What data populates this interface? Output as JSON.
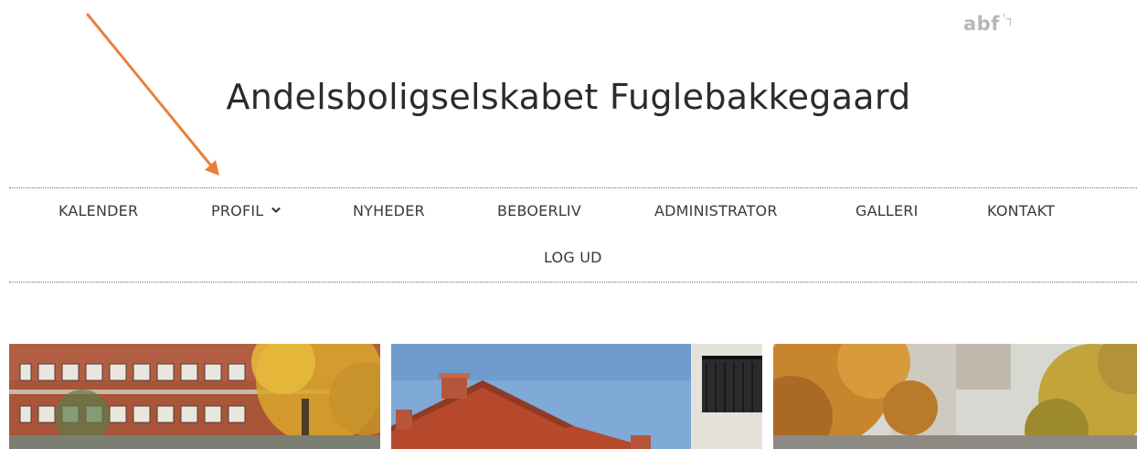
{
  "brand": {
    "logo_text": "abf",
    "logo_mark": "'┐",
    "logo_color": "#b7b7b7"
  },
  "site": {
    "title": "Andelsboligselskabet Fuglebakkegaard"
  },
  "nav": {
    "items": [
      {
        "label": "KALENDER"
      },
      {
        "label": "PROFIL",
        "has_dropdown": true,
        "icon": "chevron-down-icon"
      },
      {
        "label": "NYHEDER"
      },
      {
        "label": "BEBOERLIV"
      },
      {
        "label": "ADMINISTRATOR"
      },
      {
        "label": "GALLERI"
      },
      {
        "label": "KONTAKT"
      },
      {
        "label": "LOG UD"
      }
    ]
  },
  "annotation": {
    "type": "arrow",
    "color": "#e8803a",
    "points_to": "PROFIL"
  },
  "gallery": {
    "images": [
      {
        "subject": "red brick building with autumn tree"
      },
      {
        "subject": "red tiled roof against blue sky"
      },
      {
        "subject": "autumn trees lining street"
      }
    ]
  }
}
